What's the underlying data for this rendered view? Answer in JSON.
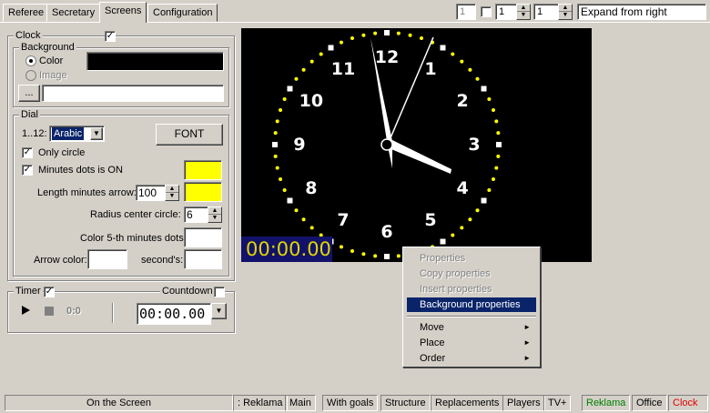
{
  "tabs": [
    "Referee",
    "Secretary",
    "Screens",
    "Configuration"
  ],
  "toolbar": {
    "field1": "1",
    "field2": "1",
    "field3": "1",
    "mode": "Expand from right"
  },
  "clock_panel": {
    "legend": "Clock",
    "background": {
      "legend": "Background",
      "color_label": "Color",
      "image_label": "Image",
      "browse_label": "...",
      "path_value": ""
    },
    "dial": {
      "legend": "Dial",
      "numerals_label": "1..12:",
      "numerals_value": "Arabic",
      "font_button": "FONT",
      "only_circle_label": "Only circle",
      "minutes_dots_label": "Minutes dots is ON",
      "length_minutes_label": "Length minutes arrow:",
      "length_minutes_value": "100",
      "radius_center_label": "Radius center circle:",
      "radius_center_value": "6",
      "color_5th_label": "Color 5-th minutes dots:",
      "arrow_color_label": "Arrow color:",
      "seconds_label": "second's:"
    },
    "colors": {
      "background": "#000000",
      "minutes_dots": "#ffff00",
      "length_arrow": "#ffff00",
      "dots_5th": "#ffffff",
      "arrow": "#ffffff",
      "seconds": "#ffffff"
    }
  },
  "timer_panel": {
    "legend": "Timer",
    "countdown_label": "Countdown",
    "elapsed": "0:0",
    "value": "00:00.00"
  },
  "preview": {
    "timer_text": "00:00.00",
    "numbers": [
      "12",
      "1",
      "2",
      "3",
      "4",
      "5",
      "6",
      "7",
      "8",
      "9",
      "10",
      "11"
    ]
  },
  "context_menu": {
    "items": [
      {
        "label": "Properties",
        "enabled": false
      },
      {
        "label": "Copy properties",
        "enabled": false
      },
      {
        "label": "Insert properties",
        "enabled": false
      },
      {
        "label": "Background properties",
        "enabled": true
      },
      {
        "label": "Move",
        "enabled": true
      },
      {
        "label": "Place",
        "enabled": true
      },
      {
        "label": "Order",
        "enabled": true
      }
    ]
  },
  "statusbar": {
    "caption": "On the Screen",
    "tabs": [
      ": Reklama",
      "Main",
      "With goals",
      "Structure",
      "Replacements",
      "Players",
      "TV+",
      "Reklama",
      "Office",
      "Clock"
    ],
    "green_color": "#008000",
    "red_color": "#e00000"
  }
}
